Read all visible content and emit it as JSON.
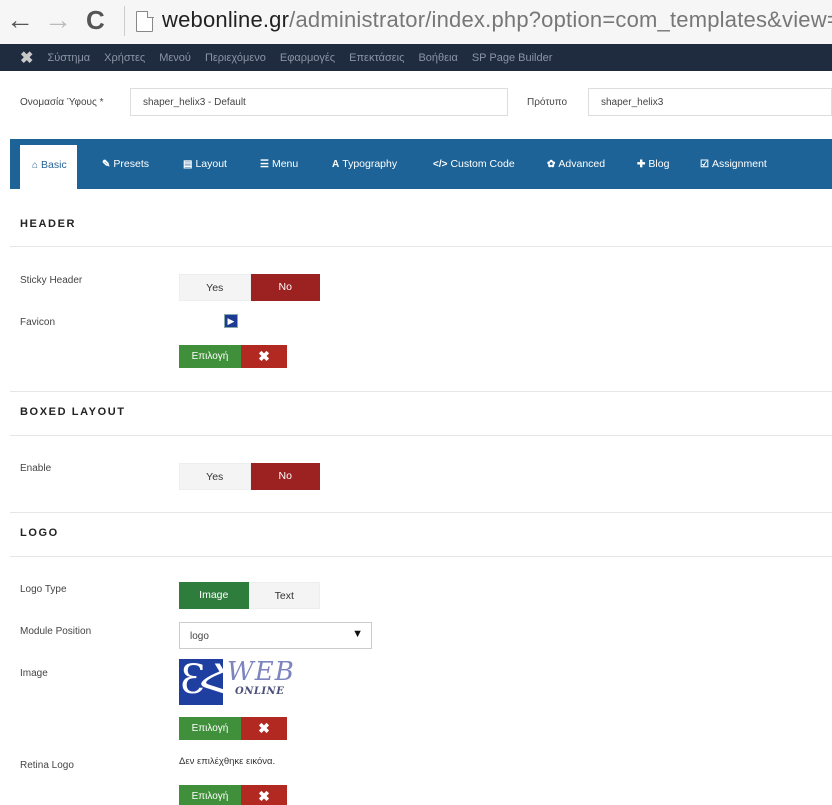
{
  "browser": {
    "back_glyph": "←",
    "forward_glyph": "→",
    "reload_glyph": "C",
    "url_host": "webonline.gr",
    "url_path": "/administrator/index.php?option=com_templates&view=st"
  },
  "admin_menu": {
    "logo_glyph": "✖",
    "items": [
      "Σύστημα",
      "Χρήστες",
      "Μενού",
      "Περιεχόμενο",
      "Εφαρμογές",
      "Επεκτάσεις",
      "Βοήθεια",
      "SP Page Builder"
    ]
  },
  "form": {
    "style_label": "Ονομασία Ύφους *",
    "style_value": "shaper_helix3 - Default",
    "template_label": "Πρότυπο",
    "template_value": "shaper_helix3"
  },
  "tabs": [
    {
      "icon": "home-icon",
      "glyph": "⌂",
      "label": "Basic",
      "active": true
    },
    {
      "icon": "pencil-icon",
      "glyph": "✎",
      "label": "Presets",
      "active": false
    },
    {
      "icon": "layout-icon",
      "glyph": "▤",
      "label": "Layout",
      "active": false
    },
    {
      "icon": "menu-icon",
      "glyph": "☰",
      "label": "Menu",
      "active": false
    },
    {
      "icon": "font-icon",
      "glyph": "A",
      "label": "Typography",
      "active": false
    },
    {
      "icon": "code-icon",
      "glyph": "</>",
      "label": "Custom Code",
      "active": false
    },
    {
      "icon": "cog-icon",
      "glyph": "✿",
      "label": "Advanced",
      "active": false
    },
    {
      "icon": "pin-icon",
      "glyph": "✚",
      "label": "Blog",
      "active": false
    },
    {
      "icon": "check-square-icon",
      "glyph": "☑",
      "label": "Assignment",
      "active": false
    }
  ],
  "header": {
    "title": "HEADER",
    "sticky_label": "Sticky Header",
    "sticky_yes": "Yes",
    "sticky_no": "No",
    "sticky_value": "No",
    "favicon_label": "Favicon",
    "favicon_glyph": "▶",
    "select_label": "Επιλογή",
    "clear_glyph": "✖"
  },
  "boxed": {
    "title": "BOXED LAYOUT",
    "enable_label": "Enable",
    "yes": "Yes",
    "no": "No",
    "value": "No"
  },
  "logo": {
    "title": "LOGO",
    "type_label": "Logo Type",
    "type_image": "Image",
    "type_text": "Text",
    "type_value": "Image",
    "module_label": "Module Position",
    "module_value": "logo",
    "module_arrow": "▼",
    "image_label": "Image",
    "logo_mark": "ƐՀ",
    "logo_web": "WEB",
    "logo_online": "ONLINE",
    "select_label": "Επιλογή",
    "clear_glyph": "✖",
    "retina_label": "Retina Logo",
    "no_image_text": "Δεν επιλέχθηκε εικόνα.",
    "retina_select_label": "Επιλογή",
    "retina_clear_glyph": "✖"
  },
  "colors": {
    "admin_bar": "#1f2b3f",
    "tab_bar": "#1e6397",
    "toggle_active_red": "#9b2220",
    "toggle_active_green": "#2f7d3d",
    "select_button": "#3f8f3b",
    "clear_button": "#b22922"
  }
}
